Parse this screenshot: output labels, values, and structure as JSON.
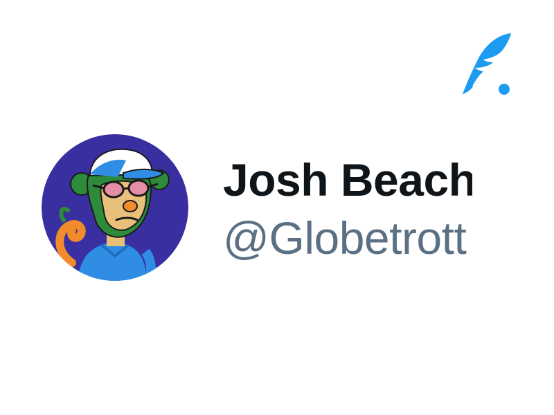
{
  "profile": {
    "display_name": "Josh Beach",
    "handle": "@Globetrott",
    "avatar_icon": "cartoon-ape-avatar-icon"
  },
  "brand": {
    "icon": "feather-quill-logo-icon",
    "accent_color": "#1d9bf0"
  },
  "colors": {
    "name": "#0f1419",
    "handle": "#5b7083",
    "avatar_background": "#3a2fa0"
  }
}
